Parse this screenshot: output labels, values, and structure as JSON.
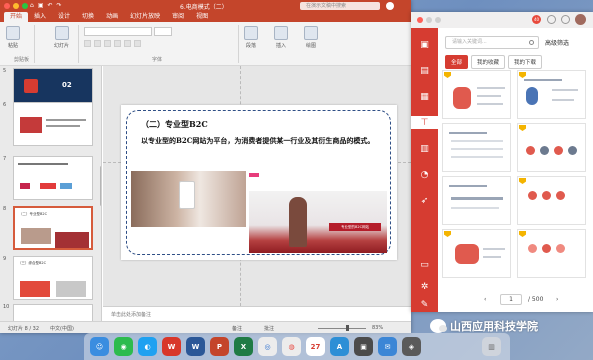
{
  "ppt": {
    "title": "6.电商模式（二）",
    "search_placeholder": "在演示文稿中搜索",
    "tabs": [
      "开始",
      "插入",
      "设计",
      "切换",
      "动画",
      "幻灯片放映",
      "审阅",
      "视图"
    ],
    "ribbon": {
      "paste": "粘贴",
      "clipboard": "剪贴板",
      "new_slide": "幻灯片",
      "font_group": "字体",
      "paragraph": "段落",
      "insert": "插入",
      "drawing": "绘图"
    },
    "thumbnails": [
      {
        "num": "5",
        "title": "02"
      },
      {
        "num": "6",
        "title": ""
      },
      {
        "num": "7",
        "title": ""
      },
      {
        "num": "8",
        "title": "（二）专业型B2C"
      },
      {
        "num": "9",
        "title": "（三）综合型B2C"
      },
      {
        "num": "10",
        "title": ""
      }
    ],
    "slide": {
      "heading": "（二）专业型B2C",
      "body": "以专业型的B2C网站为平台，为消费者提供某一行业及其衍生商品的模式。",
      "banner": "专业型的B2C网站"
    },
    "notes_placeholder": "单击此处添加备注",
    "status": {
      "slide_info": "幻灯片 8 / 32",
      "language": "中文(中国)",
      "notes": "备注",
      "comments": "批注",
      "zoom": "83%"
    }
  },
  "template_app": {
    "badge": "40",
    "search_placeholder": "请输入关键词...",
    "advanced_filter": "高级筛选",
    "tabs": [
      "全部",
      "我的收藏",
      "我的下载"
    ],
    "active_tab": "全部",
    "pager": {
      "current": "1",
      "total": "/ 500",
      "prev": "‹",
      "next": "›"
    },
    "side_icons": [
      "bookmark-icon",
      "news-icon",
      "grid-icon",
      "org-chart-icon",
      "chart-icon",
      "pie-icon",
      "rocket-icon",
      "calendar-icon",
      "settings-icon",
      "brush-icon"
    ]
  },
  "dock": {
    "apps": [
      "finder",
      "wechat",
      "qq",
      "wps",
      "word",
      "powerpoint",
      "excel",
      "safari",
      "chrome",
      "calendar",
      "trash"
    ]
  },
  "watermark": {
    "text": "山西应用科技学院"
  },
  "colors": {
    "ppt_accent": "#c4452b",
    "template_red": "#d63c31"
  }
}
